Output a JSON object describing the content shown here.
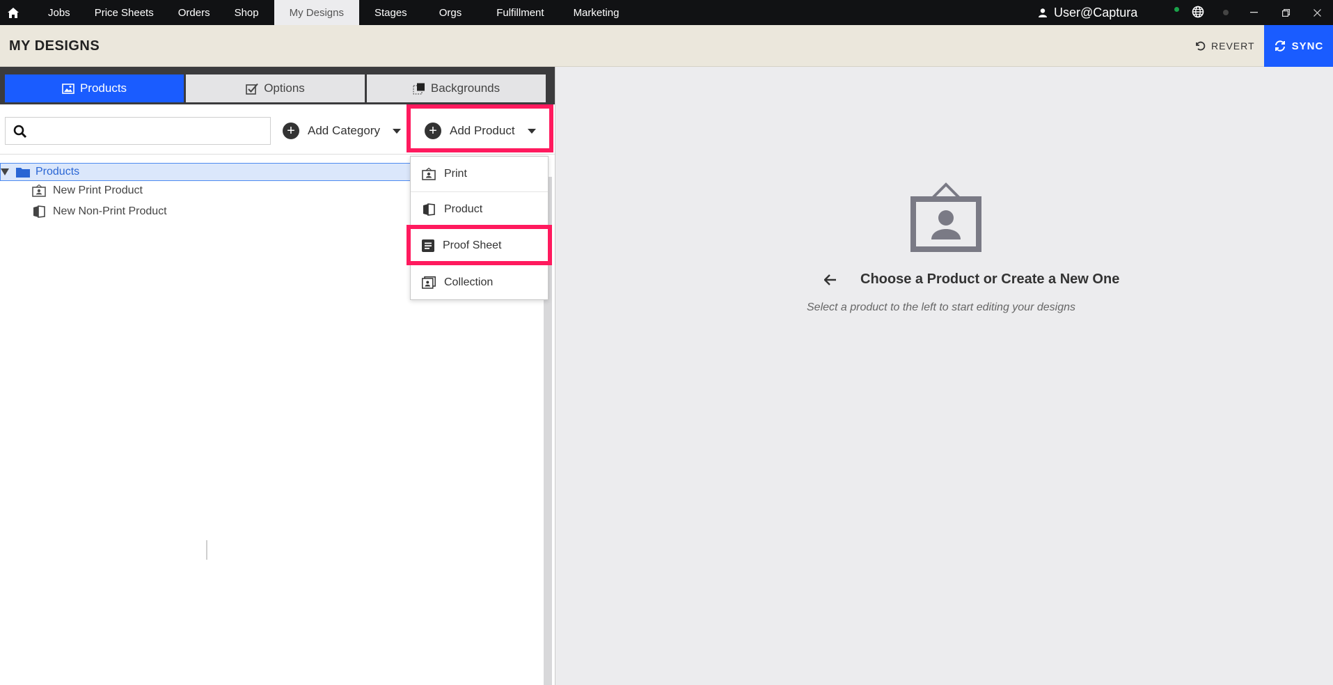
{
  "nav": {
    "items": [
      {
        "label": "Jobs"
      },
      {
        "label": "Price Sheets"
      },
      {
        "label": "Orders"
      },
      {
        "label": "Shop"
      },
      {
        "label": "My Designs",
        "active": true
      },
      {
        "label": "Stages"
      },
      {
        "label": "Orgs"
      },
      {
        "label": "Fulfillment"
      },
      {
        "label": "Marketing"
      }
    ],
    "user": "User@Captura",
    "icons": [
      "home-icon",
      "user-icon",
      "globe-icon",
      "minimize-icon",
      "restore-icon",
      "close-icon"
    ]
  },
  "header": {
    "title": "MY DESIGNS",
    "revert_label": "REVERT",
    "sync_label": "SYNC",
    "sync_color": "#1a5cff"
  },
  "tabs": [
    {
      "label": "Products",
      "icon": "image-icon",
      "active": true
    },
    {
      "label": "Options",
      "icon": "checkbox-icon"
    },
    {
      "label": "Backgrounds",
      "icon": "background-icon"
    }
  ],
  "toolbar": {
    "search_placeholder": "",
    "search_value": "",
    "add_category_label": "Add Category",
    "add_product_label": "Add Product"
  },
  "tree": {
    "root_label": "Products",
    "items": [
      {
        "label": "New Print Product",
        "icon": "print-icon"
      },
      {
        "label": "New Non-Print Product",
        "icon": "product-icon"
      }
    ]
  },
  "dropdown": {
    "items": [
      {
        "label": "Print",
        "icon": "print-icon"
      },
      {
        "label": "Product",
        "icon": "product-icon"
      },
      {
        "label": "Proof Sheet",
        "icon": "proof-sheet-icon",
        "highlighted": true
      },
      {
        "label": "Collection",
        "icon": "collection-icon"
      }
    ]
  },
  "empty_state": {
    "title": "Choose a Product or Create a New One",
    "subtitle": "Select a product to the left to start editing your designs"
  },
  "colors": {
    "highlight": "#ff1a5e",
    "accent": "#1a5cff",
    "nav_bg": "#111214",
    "header_bg": "#ebe7dc"
  }
}
